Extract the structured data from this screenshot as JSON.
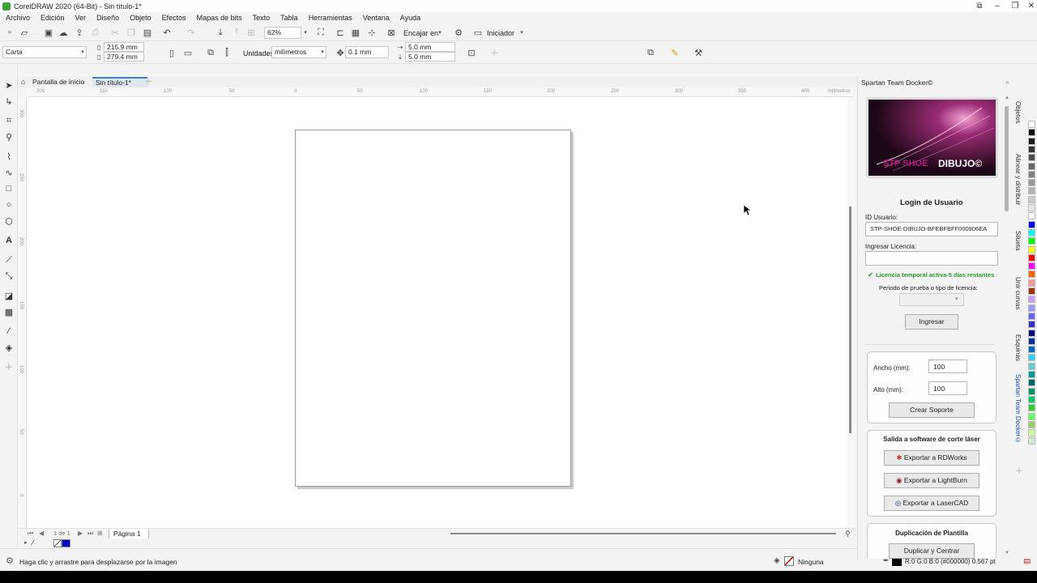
{
  "window": {
    "title": "CorelDRAW 2020 (64-Bit) - Sin título-1*",
    "controls": [
      "⧉",
      "–",
      "❐",
      "✕"
    ]
  },
  "menu": [
    "Archivo",
    "Edición",
    "Ver",
    "Diseño",
    "Objeto",
    "Efectos",
    "Mapas de bits",
    "Texto",
    "Tabla",
    "Herramientas",
    "Ventana",
    "Ayuda"
  ],
  "toolbar": {
    "zoom": "62%",
    "fit_label": "Encajar en",
    "launcher_label": "Iniciador"
  },
  "propbar": {
    "page_size": "Carta",
    "width": "215.9 mm",
    "height": "279.4 mm",
    "units_label": "Unidades:",
    "units_value": "milímetros",
    "nudge": "0.1 mm",
    "dup_x": "5.0 mm",
    "dup_y": "5.0 mm"
  },
  "tabs": {
    "home": "Pantalla de inicio",
    "doc": "Sin título-1*"
  },
  "ruler": {
    "h_labels": [
      "200",
      "150",
      "100",
      "50",
      "0",
      "50",
      "100",
      "150",
      "200",
      "250",
      "300",
      "350",
      "400",
      "milímetros"
    ],
    "v_labels": [
      "300",
      "250",
      "200",
      "150",
      "100",
      "50",
      "0"
    ]
  },
  "pagenav": {
    "page_counter": "1 de 1",
    "page_tab": "Página 1"
  },
  "status": {
    "hint": "Haga clic y arrastre para desplazarse por la imagen",
    "fill_label": "Ninguna",
    "outline": "R:0 G:0 B:0 (#000000)  0.567 pt"
  },
  "docker": {
    "title": "Spartan Team Docker©",
    "banner_text_a": "STP SHOE",
    "banner_text_b": "DIBUJO©",
    "login_title": "Login de Usuario",
    "user_id_label": "ID Usuario:",
    "user_id_value": "STP-SHOE-DIBUJO-BFEBFBFF000906EA",
    "license_label": "Ingresar Licencia:",
    "license_value": "",
    "license_status": "Licencia temporal activa-5 días restantes",
    "period_label": "Periodo de prueba o tipo de licencia:",
    "period_value": "",
    "login_button": "Ingresar",
    "width_label": "Ancho (mm):",
    "width_value": "100",
    "height_label": "Alto (mm):",
    "height_value": "100",
    "create_support": "Crear Soporte",
    "laser_title": "Salida a software de corte láser",
    "export_rdworks": "Exportar a RDWorks",
    "export_lightburn": "Exportar a LightBurn",
    "export_lasercad": "Exportar a LaserCAD",
    "template_title": "Duplicación de Plantilla",
    "duplicate_center": "Duplicar y Centrar"
  },
  "vtabs": [
    "Objetos",
    "Alinear y distribuir",
    "Silueta",
    "Unir curvas",
    "Esquinas",
    "Spartan Team Docker©"
  ],
  "palette": [
    "#ffffff",
    "#000000",
    "#1a1a1a",
    "#333333",
    "#4d4d4d",
    "#666666",
    "#808080",
    "#999999",
    "#b3b3b3",
    "#cccccc",
    "#e6e6e6",
    "#ffffff",
    "#0000ff",
    "#00ffff",
    "#00ff00",
    "#ffff00",
    "#ff0000",
    "#ff00ff",
    "#ff6600",
    "#ff9999",
    "#993300",
    "#cc99ff",
    "#9999ff",
    "#6666ff",
    "#3333cc",
    "#000080",
    "#003399",
    "#0066cc",
    "#33ccff",
    "#66cccc",
    "#009999",
    "#006666",
    "#009966",
    "#00cc66",
    "#33cc33",
    "#66ff66",
    "#99cc66",
    "#ccff99",
    "#cceecc"
  ],
  "accent": "#3b7ddd"
}
